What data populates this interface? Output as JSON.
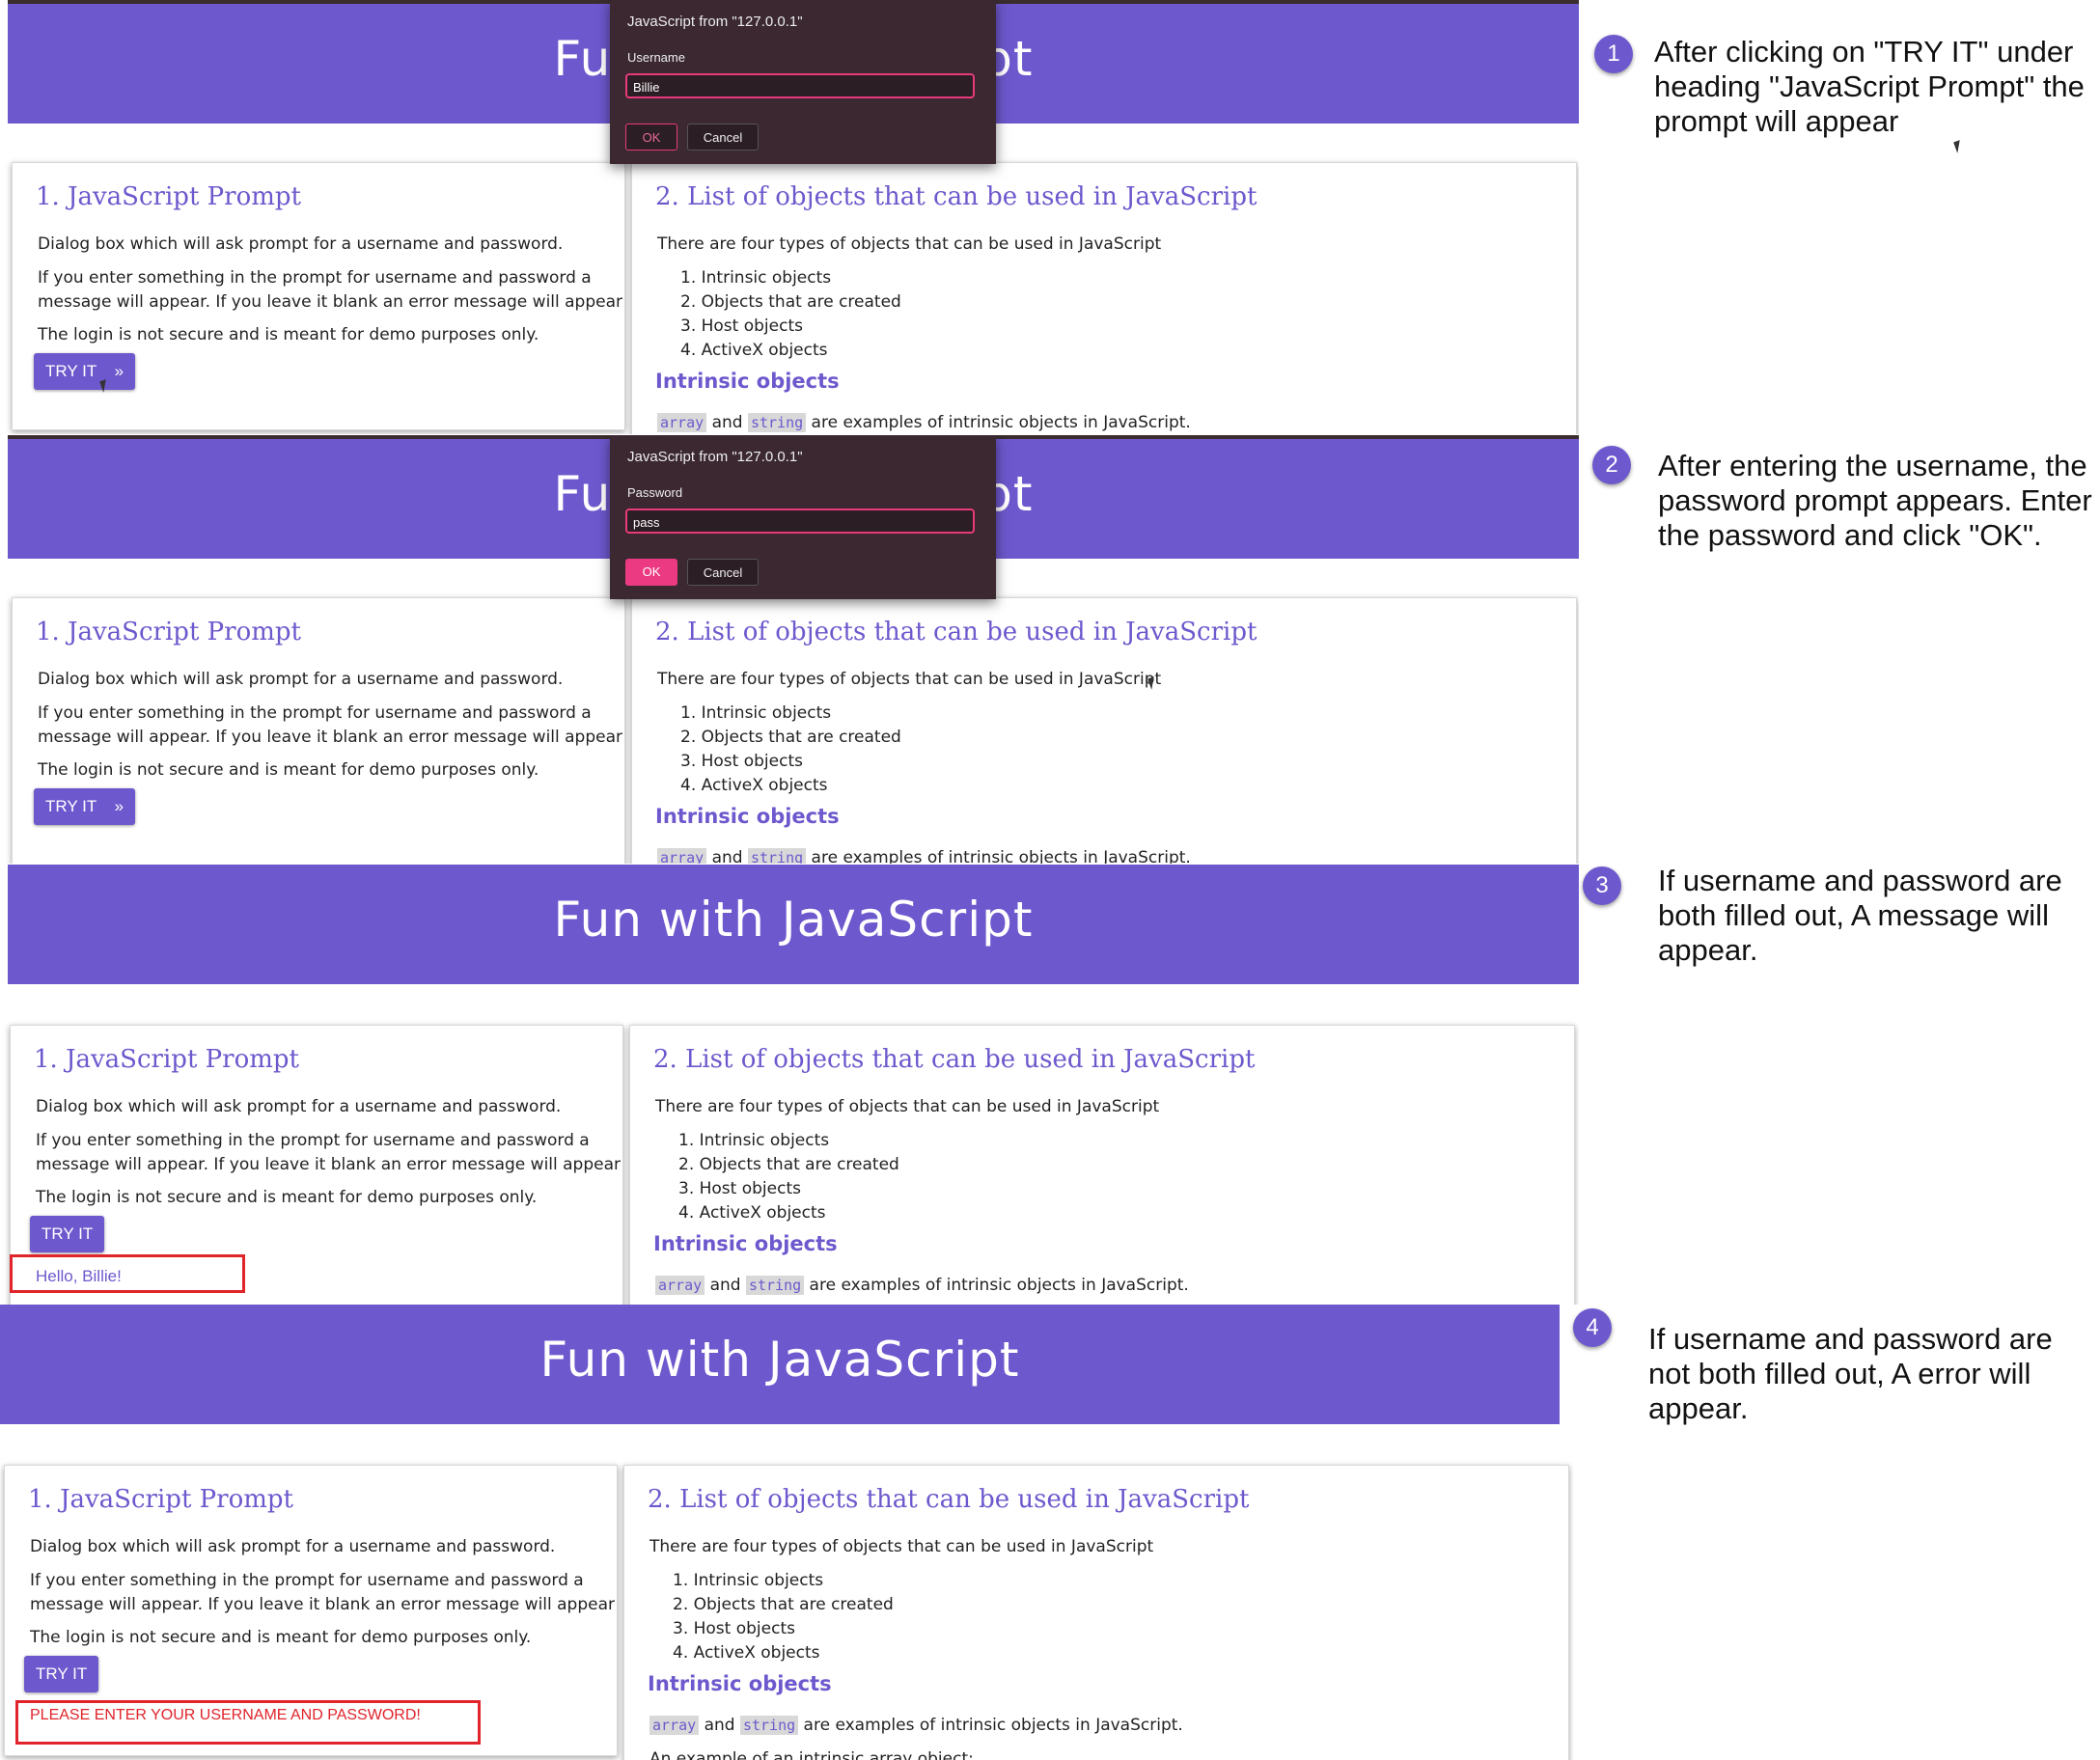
{
  "site": {
    "title": "Fun with JavaScript"
  },
  "left_card": {
    "heading": "1. JavaScript Prompt",
    "p1": "Dialog box which will ask prompt for a username and password.",
    "p2a": "If you enter something in the prompt for username and password a",
    "p2b": "message will appear. If you leave it blank an error message will appear",
    "p3": "The login is not secure and is meant for demo purposes only.",
    "button": "TRY IT",
    "button_arrow": "»"
  },
  "right_card": {
    "heading": "2. List of objects that can be used in JavaScript",
    "intro": "There are four types of objects that can be used in JavaScript",
    "items": [
      "1. Intrinsic objects",
      "2. Objects that are created",
      "3. Host objects",
      "4. ActiveX objects"
    ],
    "subheading": "Intrinsic objects",
    "code1": "array",
    "and": "and",
    "code2": "string",
    "tail": "are examples of intrinsic objects in JavaScript.",
    "extra": "An example of an intrinsic array object:"
  },
  "dialog1": {
    "title": "JavaScript from \"127.0.0.1\"",
    "label": "Username",
    "value": "Billie",
    "ok": "OK",
    "cancel": "Cancel"
  },
  "dialog2": {
    "title": "JavaScript from \"127.0.0.1\"",
    "label": "Password",
    "value": "pass",
    "ok": "OK",
    "cancel": "Cancel"
  },
  "messages": {
    "success": "Hello, Billie!",
    "error": "PLEASE ENTER YOUR USERNAME AND PASSWORD!"
  },
  "steps": [
    {
      "num": "1",
      "l1": "After clicking on \"TRY IT\" under",
      "l2": "heading \"JavaScript Prompt\" the",
      "l3": "prompt will appear"
    },
    {
      "num": "2",
      "l1": "After entering the username, the",
      "l2": "password prompt appears. Enter",
      "l3": "the password and click \"OK\"."
    },
    {
      "num": "3",
      "l1": "If username and password are",
      "l2": "both filled out, A message will",
      "l3": "appear."
    },
    {
      "num": "4",
      "l1": "If username and password are",
      "l2": "not both filled out, A error will",
      "l3": "appear."
    }
  ],
  "colors": {
    "accent": "#6e58cd",
    "dialog_bg": "#3b2831",
    "ok_active": "#ec3a82",
    "error_red": "#e0242a"
  }
}
